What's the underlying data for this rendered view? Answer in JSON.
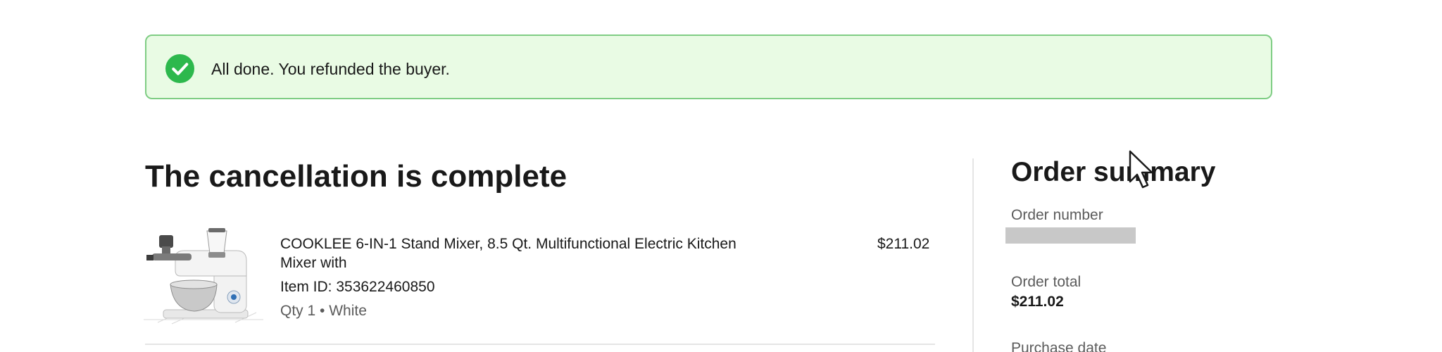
{
  "banner": {
    "message": "All done. You refunded the buyer.",
    "icon": "check-circle-icon",
    "accent_color": "#2db84d",
    "background_color": "#e9fbe4",
    "border_color": "#7fcd84"
  },
  "main": {
    "title": "The cancellation is complete",
    "item": {
      "image_icon": "stand-mixer-product-image",
      "title": "COOKLEE 6-IN-1 Stand Mixer, 8.5 Qt. Multifunctional Electric Kitchen Mixer with",
      "price": "$211.02",
      "item_id": "Item ID: 353622460850",
      "meta": "Qty 1 • White"
    }
  },
  "summary": {
    "title": "Order summary",
    "order_number_label": "Order number",
    "order_number_value": "",
    "order_total_label": "Order total",
    "order_total_value": "$211.02",
    "purchase_date_label": "Purchase date"
  }
}
